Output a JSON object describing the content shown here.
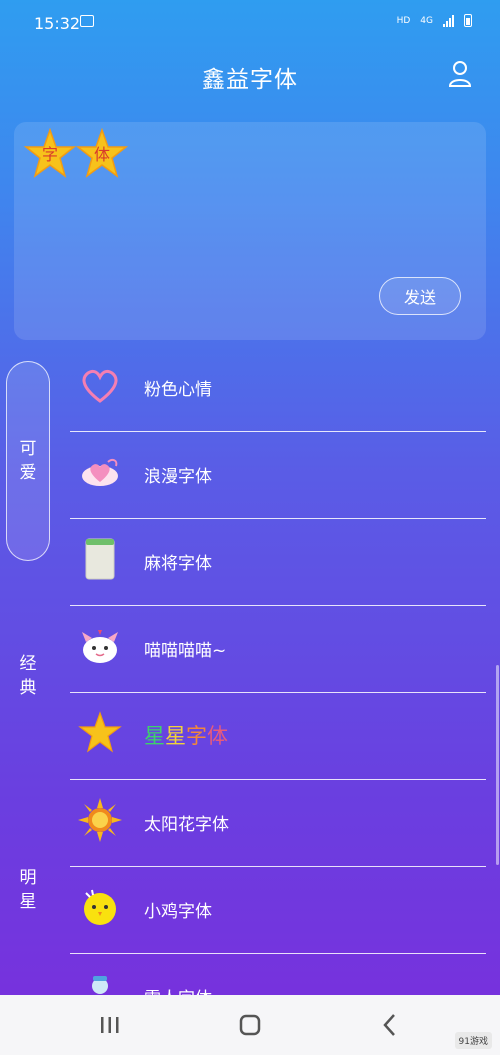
{
  "status_bar": {
    "time": "15:32",
    "network_hd": "HD",
    "network_type": "4G"
  },
  "header": {
    "title": "鑫益字体",
    "user_icon": "user-icon"
  },
  "preview": {
    "chars": [
      "字",
      "体"
    ],
    "send_label": "发送"
  },
  "categories": [
    {
      "label": "可爱",
      "active": true
    },
    {
      "label": "经典",
      "active": false
    },
    {
      "label": "明星",
      "active": false
    }
  ],
  "fonts": [
    {
      "name": "粉色心情",
      "icon": "pink-heart-icon"
    },
    {
      "name": "浪漫字体",
      "icon": "romantic-heart-icon"
    },
    {
      "name": "麻将字体",
      "icon": "mahjong-tile-icon"
    },
    {
      "name": "喵喵喵喵~",
      "icon": "cat-icon"
    },
    {
      "name": "星星字体",
      "icon": "star-icon",
      "colors": [
        "#3ed16b",
        "#f0d23a",
        "#f1873b",
        "#e65b7c"
      ]
    },
    {
      "name": "太阳花字体",
      "icon": "sunflower-icon"
    },
    {
      "name": "小鸡字体",
      "icon": "chick-icon"
    },
    {
      "name": "雪人字体",
      "icon": "snowman-icon"
    }
  ],
  "nav": {
    "recents_icon": "recents-icon",
    "home_icon": "home-icon",
    "back_icon": "back-icon"
  },
  "watermark": {
    "text": "91游戏",
    "logo_text": "91游戏"
  },
  "colors": {
    "gradient_top": "#2f9df0",
    "gradient_bottom": "#7a2edc",
    "star_gold": "#f7c21b",
    "char_red": "#d83a2b"
  }
}
